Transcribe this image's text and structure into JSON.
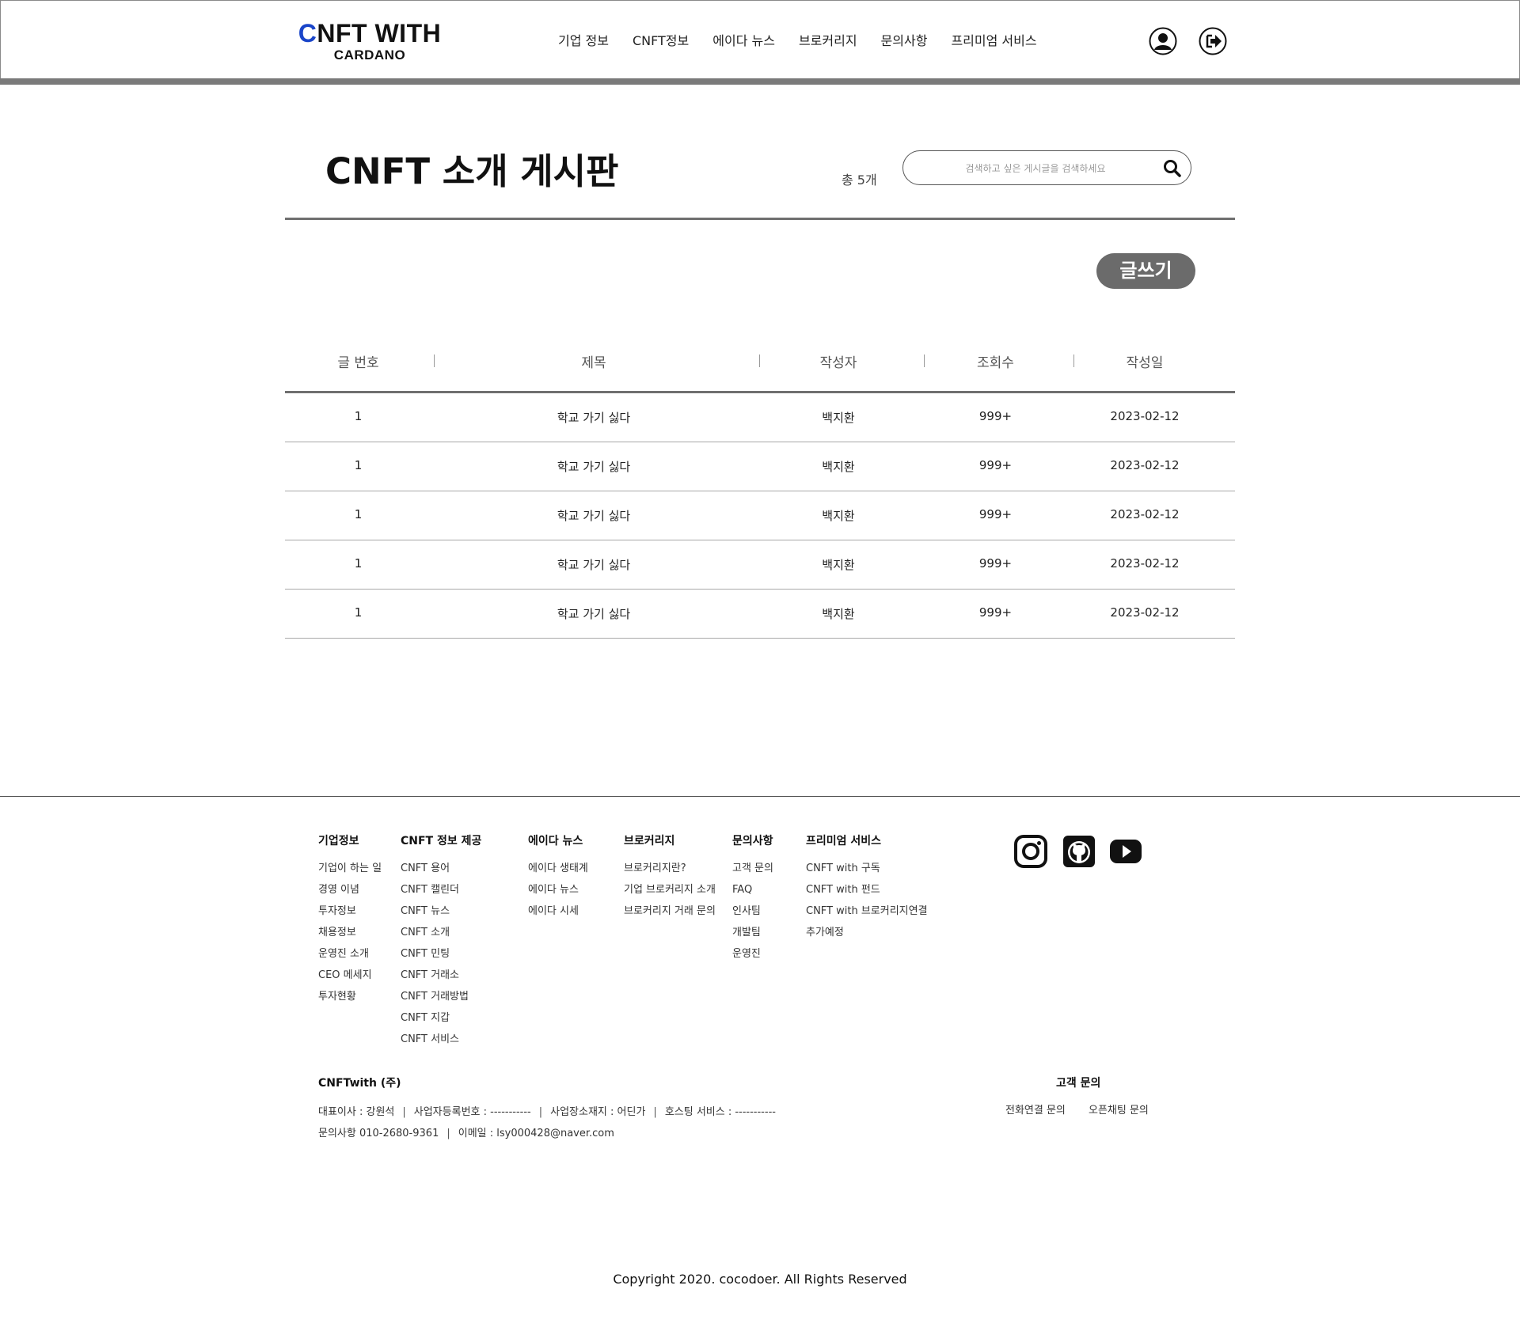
{
  "header": {
    "logo_first_letter": "C",
    "logo_rest": "NFT WITH",
    "logo_sub": "CARDANO",
    "nav": [
      "기업 정보",
      "CNFT정보",
      "에이다 뉴스",
      "브로커리지",
      "문의사항",
      "프리미엄 서비스"
    ],
    "icons": [
      "user-icon",
      "logout-icon"
    ],
    "accent_color": "#1a45c9"
  },
  "board": {
    "title": "CNFT 소개 게시판",
    "total": "총 5개",
    "search_placeholder": "검색하고 싶은 게시글을 검색하세요",
    "write_label": "글쓰기",
    "columns": [
      "글 번호",
      "제목",
      "작성자",
      "조회수",
      "작성일"
    ],
    "rows": [
      {
        "num": "1",
        "title": "학교 가기 싫다",
        "author": "백지환",
        "views": "999+",
        "date": "2023-02-12"
      },
      {
        "num": "1",
        "title": "학교 가기 싫다",
        "author": "백지환",
        "views": "999+",
        "date": "2023-02-12"
      },
      {
        "num": "1",
        "title": "학교 가기 싫다",
        "author": "백지환",
        "views": "999+",
        "date": "2023-02-12"
      },
      {
        "num": "1",
        "title": "학교 가기 싫다",
        "author": "백지환",
        "views": "999+",
        "date": "2023-02-12"
      },
      {
        "num": "1",
        "title": "학교 가기 싫다",
        "author": "백지환",
        "views": "999+",
        "date": "2023-02-12"
      }
    ]
  },
  "footer": {
    "columns": [
      {
        "heading": "기업정보",
        "items": [
          "기업이 하는 일",
          "경영 이념",
          "투자정보",
          "채용정보",
          "운영진 소개",
          "CEO 메세지",
          "투자현황"
        ]
      },
      {
        "heading": "CNFT 정보 제공",
        "items": [
          "CNFT 용어",
          "CNFT 캘린더",
          "CNFT 뉴스",
          "CNFT 소개",
          "CNFT 민팅",
          "CNFT 거래소",
          "CNFT 거래방법",
          "CNFT 지갑",
          "CNFT 서비스"
        ]
      },
      {
        "heading": "에이다 뉴스",
        "items": [
          "에이다 생태계",
          "에이다 뉴스",
          "에이다 시세"
        ]
      },
      {
        "heading": "브로커리지",
        "items": [
          "브로커리지란?",
          "기업 브로커리지 소개",
          "브로커리지 거래 문의"
        ]
      },
      {
        "heading": "문의사항",
        "items": [
          "고객 문의",
          "FAQ",
          "인사팀",
          "개발팀",
          "운영진"
        ]
      },
      {
        "heading": "프리미엄 서비스",
        "items": [
          "CNFT with 구독",
          "CNFT with 펀드",
          "CNFT with 브로커리지연결",
          "추가예정"
        ]
      }
    ],
    "social": [
      "instagram-icon",
      "github-icon",
      "youtube-icon"
    ],
    "company": "CNFTwith (주)",
    "info1": [
      "대표이사 : 강원석",
      "사업자등록번호 : -----------",
      "사업장소재지 : 어딘가",
      "호스팅 서비스 : -----------"
    ],
    "info2": [
      "문의사항  010-2680-9361",
      "이메일 : lsy000428@naver.com"
    ],
    "cs_title": "고객 문의",
    "cs_links": [
      "전화연결 문의",
      "오픈채팅 문의"
    ],
    "copyright": "Copyright 2020. cocodoer. All Rights Reserved"
  }
}
